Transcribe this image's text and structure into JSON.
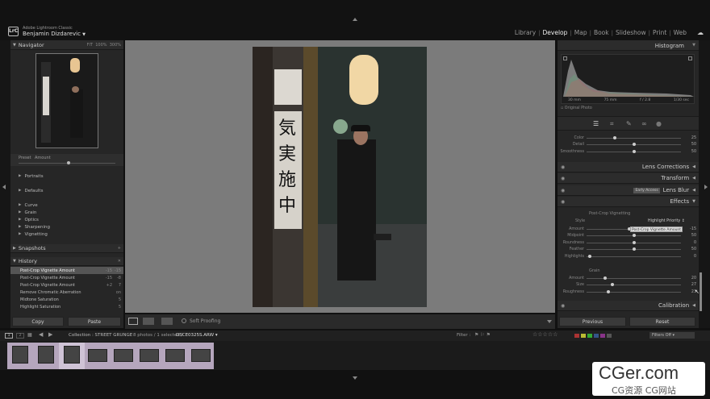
{
  "app": {
    "logo_text": "LrC",
    "name": "Adobe Lightroom Classic",
    "user": "Benjamin Dizdarevic"
  },
  "modules": [
    {
      "label": "Library",
      "active": false
    },
    {
      "label": "Develop",
      "active": true
    },
    {
      "label": "Map",
      "active": false
    },
    {
      "label": "Book",
      "active": false
    },
    {
      "label": "Slideshow",
      "active": false
    },
    {
      "label": "Print",
      "active": false
    },
    {
      "label": "Web",
      "active": false
    }
  ],
  "left": {
    "navigator": {
      "title": "Navigator",
      "zoom": [
        "FIT",
        "100%",
        "300%"
      ]
    },
    "presets_tabs": [
      "Preset",
      "Amount"
    ],
    "presets": [
      "Portraits",
      "Defaults",
      "Curve",
      "Grain",
      "Optics",
      "Sharpening",
      "Vignetting"
    ],
    "snapshots": {
      "title": "Snapshots"
    },
    "history": {
      "title": "History",
      "items": [
        {
          "label": "Post-Crop Vignette Amount",
          "v1": "-15",
          "v2": "-15",
          "selected": true
        },
        {
          "label": "Post-Crop Vignette Amount",
          "v1": "-15",
          "v2": "-8",
          "selected": false
        },
        {
          "label": "Post-Crop Vignette Amount",
          "v1": "+2",
          "v2": "7",
          "selected": false
        },
        {
          "label": "Remove Chromatic Aberration",
          "v1": "",
          "v2": "on",
          "selected": false
        },
        {
          "label": "Midtone Saturation",
          "v1": "",
          "v2": "5",
          "selected": false
        },
        {
          "label": "Highlight Saturation",
          "v1": "",
          "v2": "5",
          "selected": false
        }
      ]
    },
    "copy_label": "Copy",
    "paste_label": "Paste"
  },
  "toolbar": {
    "soft_proofing": "Soft Proofing"
  },
  "right": {
    "histogram": {
      "title": "Histogram",
      "info": [
        "30 mm",
        "75 mm",
        "f / 2.8",
        "1/30 sec"
      ],
      "original_photo": "Original Photo"
    },
    "top_rows": [
      {
        "label": "Color",
        "value": "25",
        "pos": 0.3
      },
      {
        "label": "Detail",
        "value": "50",
        "pos": 0.5
      },
      {
        "label": "Smoothness",
        "value": "50",
        "pos": 0.5
      }
    ],
    "lens_corrections": "Lens Corrections",
    "transform": "Transform",
    "lens_blur": "Lens Blur",
    "lens_blur_badge": "Early Access",
    "effects": {
      "title": "Effects",
      "vignette_title": "Post-Crop Vignetting",
      "style_label": "Style",
      "style_value": "Highlight Priority",
      "amount_tooltip": "Post-Crop Vignette Amount",
      "rows": [
        {
          "label": "Amount",
          "value": "-15",
          "pos": 0.45
        },
        {
          "label": "Midpoint",
          "value": "50",
          "pos": 0.5
        },
        {
          "label": "Roundness",
          "value": "0",
          "pos": 0.5
        },
        {
          "label": "Feather",
          "value": "50",
          "pos": 0.5
        },
        {
          "label": "Highlights",
          "value": "0",
          "pos": 0.03
        }
      ],
      "grain_title": "Grain",
      "grain_rows": [
        {
          "label": "Amount",
          "value": "20",
          "pos": 0.2
        },
        {
          "label": "Size",
          "value": "27",
          "pos": 0.27
        },
        {
          "label": "Roughness",
          "value": "23",
          "pos": 0.23
        }
      ]
    },
    "calibration": "Calibration",
    "previous_label": "Previous",
    "reset_label": "Reset"
  },
  "filmbar": {
    "pages": [
      "1",
      "2"
    ],
    "collection": "Collection : STREET GRUNGE",
    "count": "8 photos / 1 selected /",
    "filename": "DSCE0325S.ARW",
    "filter_label": "Filter :",
    "filters_off": "Filters Off"
  },
  "filmstrip": {
    "count": 8,
    "selected_index": 2
  },
  "watermark": {
    "title": "CGer.com",
    "subtitle": "CG资源 CG网站"
  },
  "colors": {
    "accent": "#eeeeee",
    "filmstrip_thumb": "#b5a6bd",
    "label_swatches": [
      "#a33",
      "#bb3",
      "#3a3",
      "#358",
      "#838",
      "#555"
    ]
  }
}
